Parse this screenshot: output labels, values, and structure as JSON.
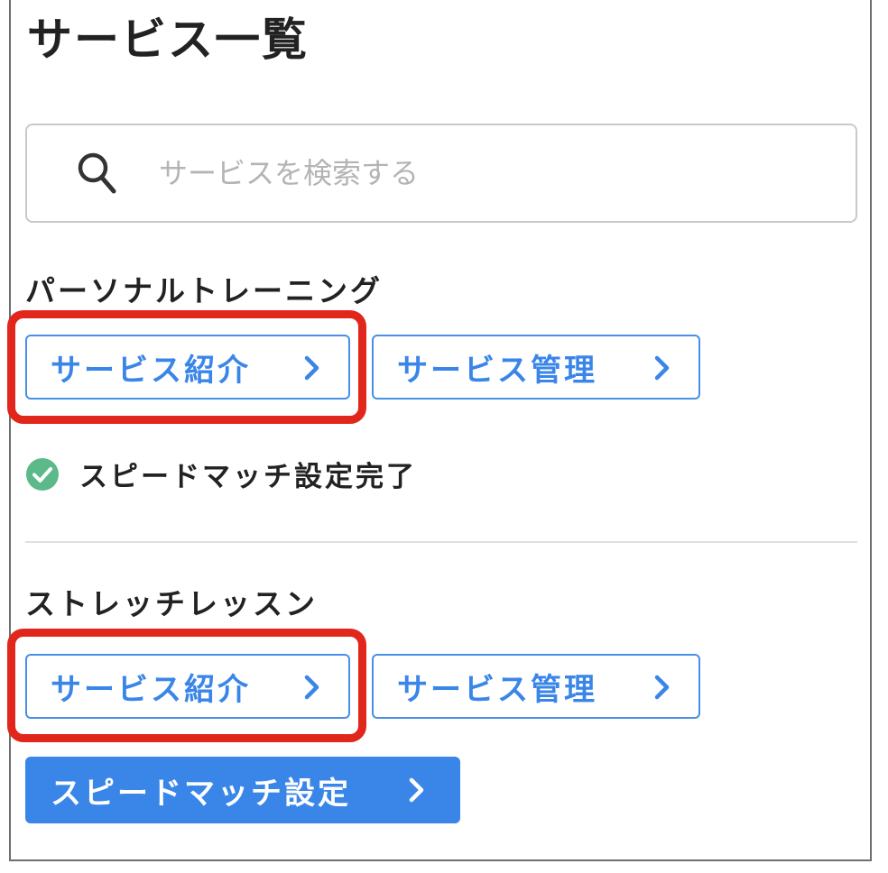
{
  "page": {
    "title": "サービス一覧"
  },
  "search": {
    "placeholder": "サービスを検索する",
    "icon": "search-icon"
  },
  "sections": [
    {
      "title": "パーソナルトレーニング",
      "intro_label": "サービス紹介",
      "manage_label": "サービス管理",
      "status_text": "スピードマッチ設定完了",
      "status_icon": "check-circle-icon"
    },
    {
      "title": "ストレッチレッスン",
      "intro_label": "サービス紹介",
      "manage_label": "サービス管理",
      "speedmatch_label": "スピードマッチ設定"
    }
  ],
  "colors": {
    "accent": "#3a86e8",
    "highlight": "#e1261c",
    "success": "#5bb98a",
    "text": "#222222"
  }
}
